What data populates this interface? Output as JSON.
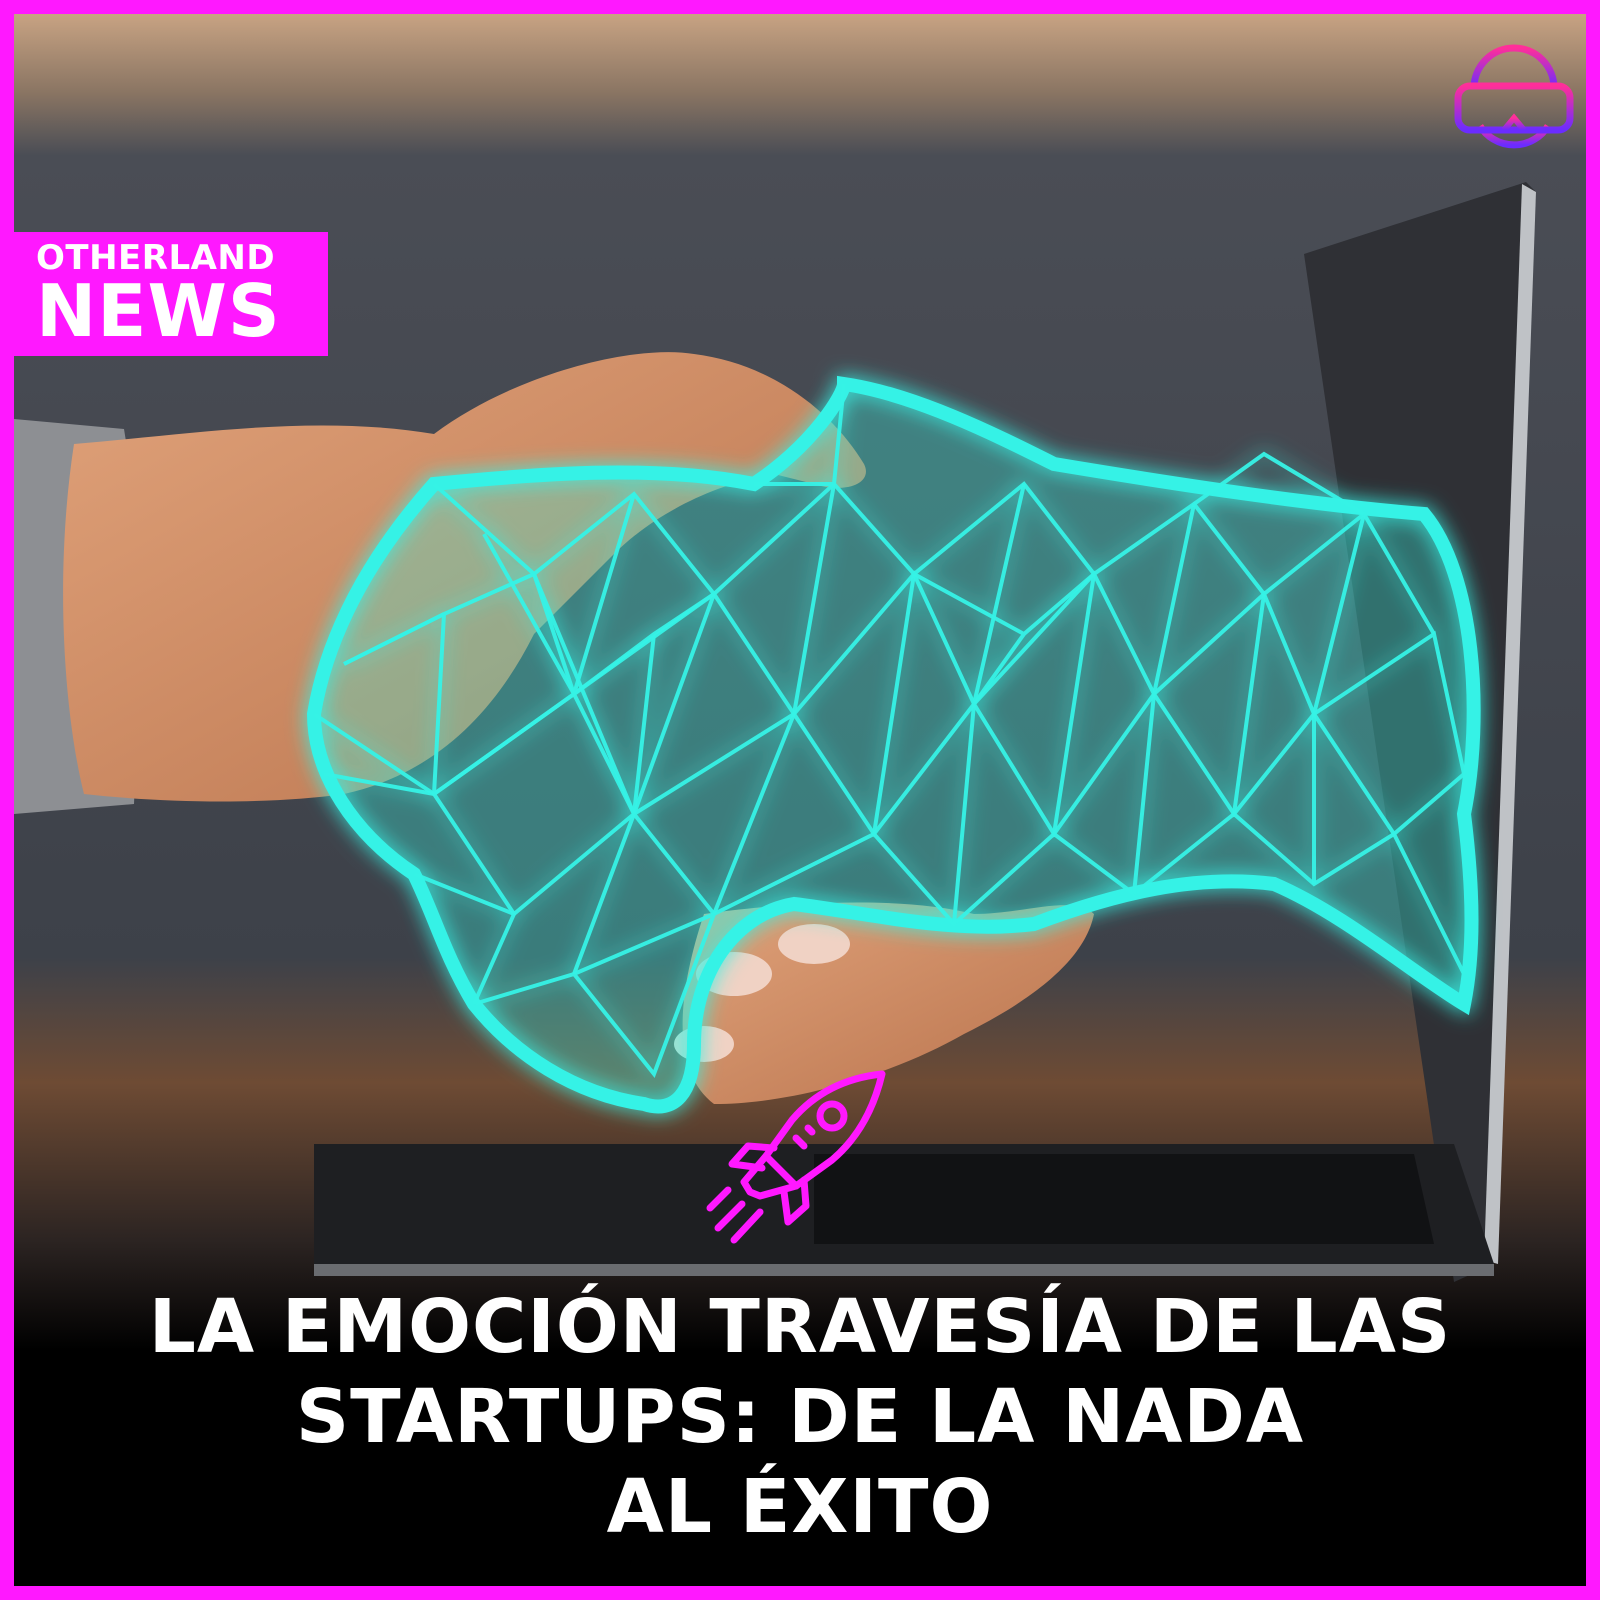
{
  "brand": {
    "line1": "OTHERLAND",
    "line2": "NEWS"
  },
  "headline": {
    "line1": "LA EMOCIÓN TRAVESÍA DE LAS",
    "line2": "STARTUPS: DE LA NADA",
    "line3": "AL ÉXITO"
  },
  "colors": {
    "accent": "#ff18ff",
    "hologram": "#35f2e6",
    "text": "#ffffff"
  },
  "icons": {
    "logo": "vr-headset-icon",
    "rocket": "rocket-icon"
  }
}
